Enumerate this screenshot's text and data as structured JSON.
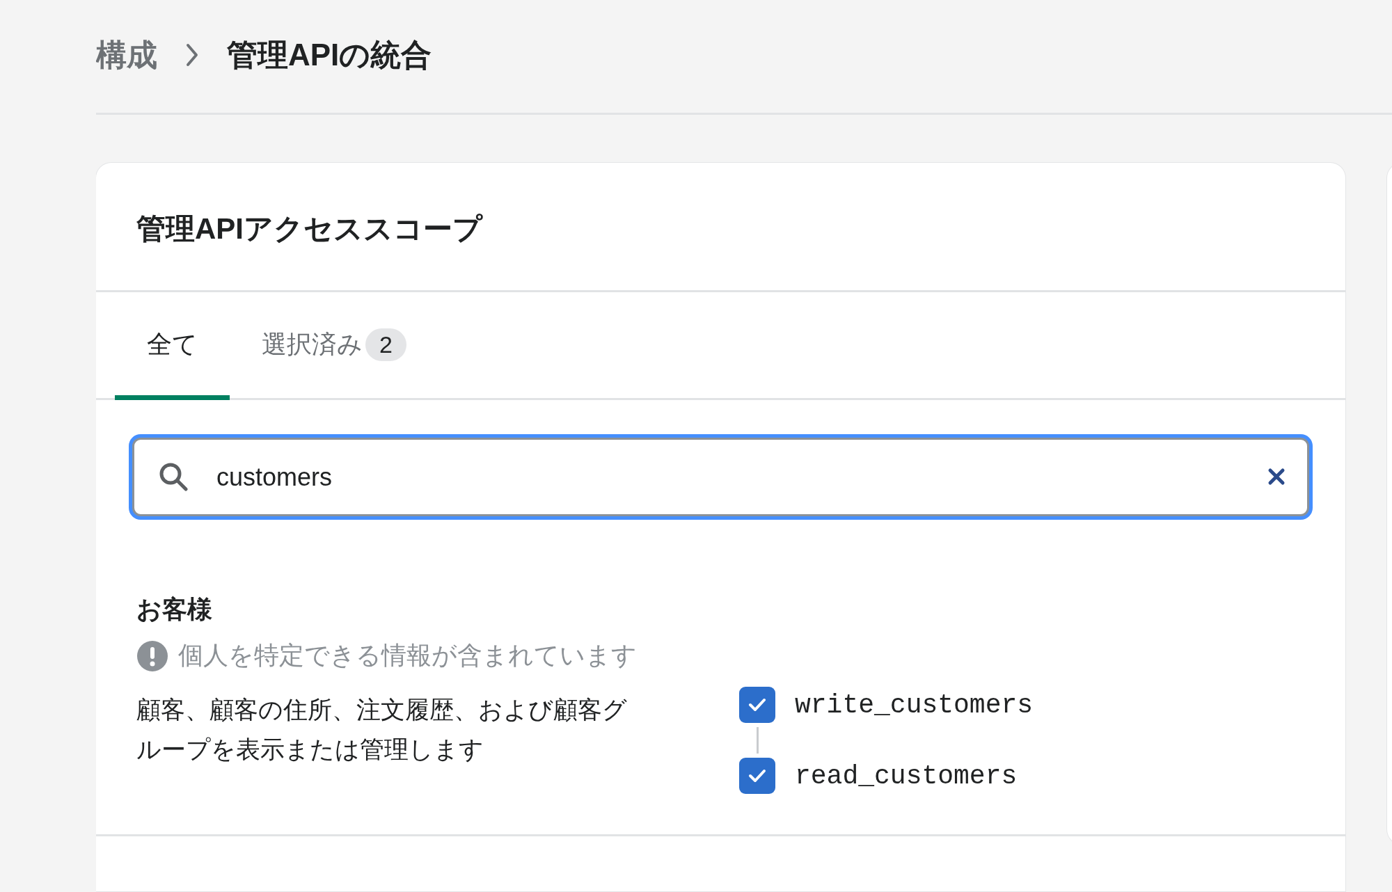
{
  "breadcrumb": {
    "parent": "構成",
    "current": "管理APIの統合"
  },
  "card": {
    "title": "管理APIアクセススコープ",
    "tabs": [
      {
        "label": "全て",
        "selected": true
      },
      {
        "label": "選択済み",
        "count": "2",
        "selected": false
      }
    ],
    "search": {
      "value": "customers"
    },
    "groups": [
      {
        "title": "お客様",
        "warning": "個人を特定できる情報が含まれています",
        "description": "顧客、顧客の住所、注文履歴、および顧客グループを表示または管理します",
        "scopes": [
          {
            "name": "write_customers",
            "checked": true
          },
          {
            "name": "read_customers",
            "checked": true
          }
        ]
      }
    ]
  }
}
